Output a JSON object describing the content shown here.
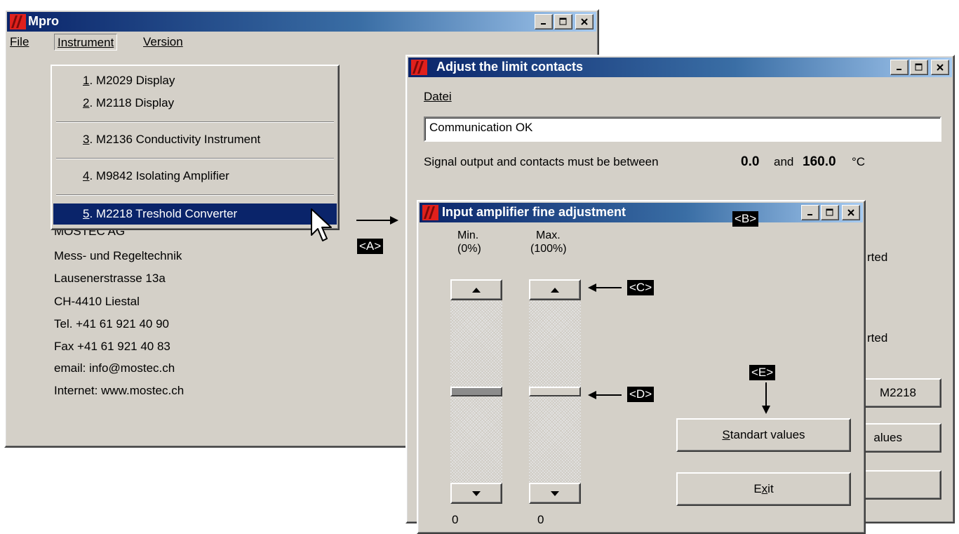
{
  "mpro": {
    "title": "Mpro",
    "menu": {
      "file": "File",
      "instrument": "Instrument",
      "version": "Version"
    },
    "instrument_menu": {
      "item1": {
        "num": "1",
        "label": ". M2029 Display"
      },
      "item2": {
        "num": "2",
        "label": ". M2118 Display"
      },
      "item3": {
        "num": "3",
        "label": ". M2136 Conductivity Instrument"
      },
      "item4": {
        "num": "4",
        "label": ". M9842 Isolating Amplifier"
      },
      "item5": {
        "num": "5",
        "label": ". M2218 Treshold Converter"
      }
    },
    "address": [
      "MOSTEC AG",
      "Mess- und Regeltechnik",
      "Lausenerstrasse 13a",
      "CH-4410 Liestal",
      "Tel. +41 61 921 40 90",
      "Fax +41 61 921 40 83",
      "email: info@mostec.ch",
      "Internet: www.mostec.ch"
    ]
  },
  "limits": {
    "title": "Adjust the limit contacts",
    "menu_datei": "Datei",
    "status_field": "Communication OK",
    "range_text": "Signal output and contacts must be between",
    "min_value": "0.0",
    "and_text": "and",
    "max_value": "160.0",
    "unit": "°C",
    "partial_text_1": "rted",
    "partial_text_2": "rted",
    "partial_button_1": "M2218",
    "partial_button_2": "alues"
  },
  "amp": {
    "title": "Input amplifier fine adjustment",
    "min_label_line1": "Min.",
    "min_label_line2": "(0%)",
    "max_label_line1": "Max.",
    "max_label_line2": "(100%)",
    "min_value": "0",
    "max_value": "0",
    "min_level_percent": 50,
    "max_level_percent": 50,
    "standard_button": "Standart values",
    "exit_button": "Exit"
  },
  "callouts": {
    "a": "<A>",
    "b": "<B>",
    "c": "<C>",
    "d": "<D>",
    "e": "<E>"
  },
  "colors": {
    "titlebar": "#0a246a",
    "face": "#d4d0c8",
    "selection": "#0a246a",
    "icon_red": "#e0201c"
  },
  "icons": {
    "app": "mostec-logo-icon",
    "minimize": "minimize-icon",
    "maximize": "maximize-icon",
    "close": "close-icon"
  }
}
